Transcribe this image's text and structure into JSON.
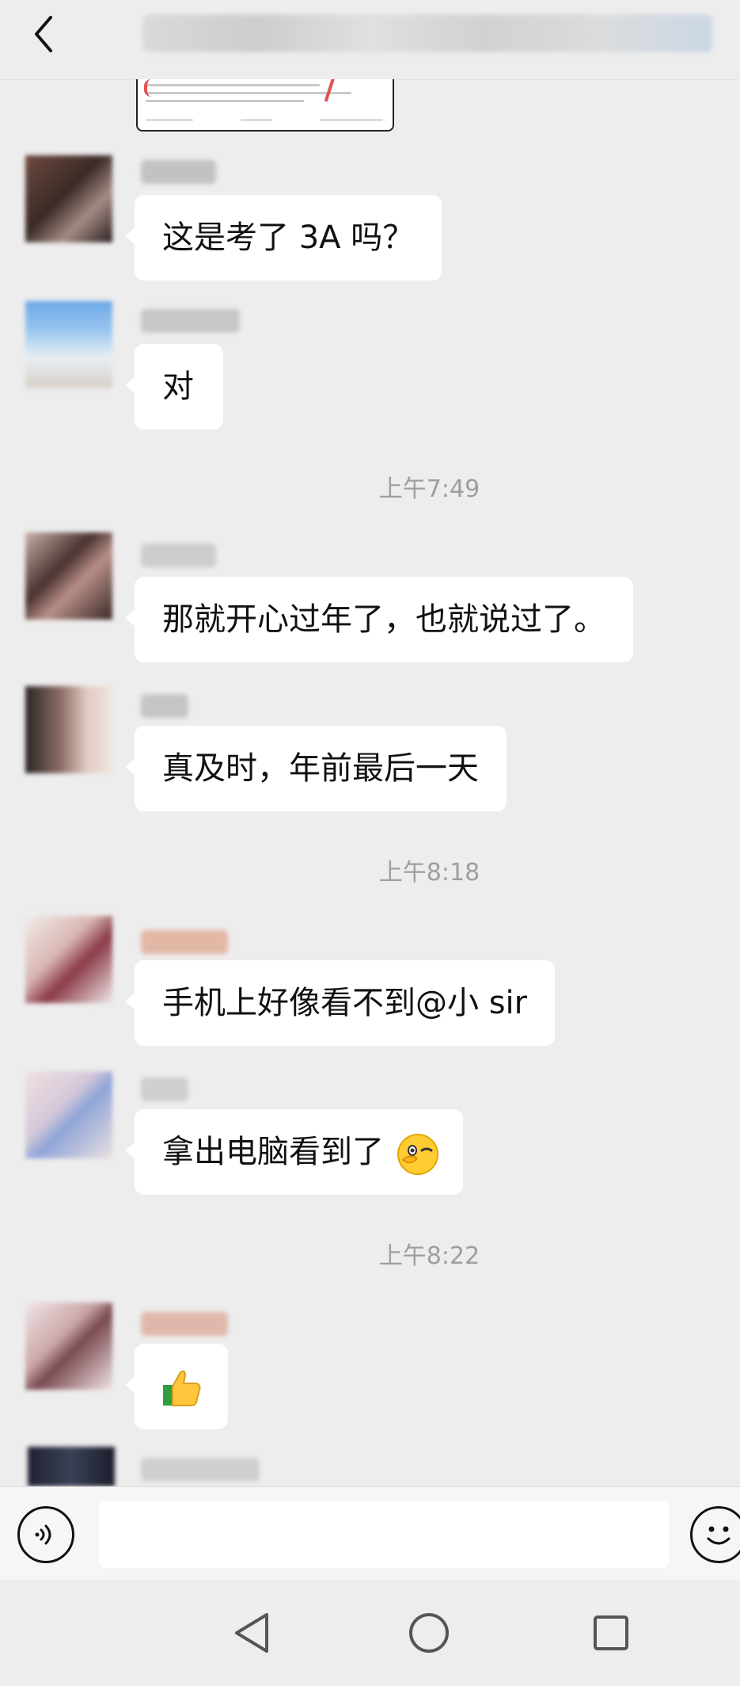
{
  "messages": [
    {
      "text": "这是考了 3A 吗？"
    },
    {
      "text": "对"
    },
    {
      "text": "那就开心过年了，也就说过了。"
    },
    {
      "text": "真及时，年前最后一天"
    },
    {
      "text": "手机上好像看不到@小 sir"
    },
    {
      "text": "拿出电脑看到了"
    },
    {
      "text": ""
    }
  ],
  "timestamps": [
    "上午7:49",
    "上午8:18",
    "上午8:22"
  ],
  "input": {
    "placeholder": ""
  },
  "icons": {
    "back": "chevron-left-icon",
    "voice": "voice-icon",
    "emoji": "smiley-face-icon",
    "nav_back": "triangle-back-icon",
    "nav_home": "circle-home-icon",
    "nav_recent": "square-recent-icon"
  },
  "colors": {
    "background": "#ededed",
    "bubble": "#ffffff",
    "timestamp": "#9e9e9e"
  }
}
